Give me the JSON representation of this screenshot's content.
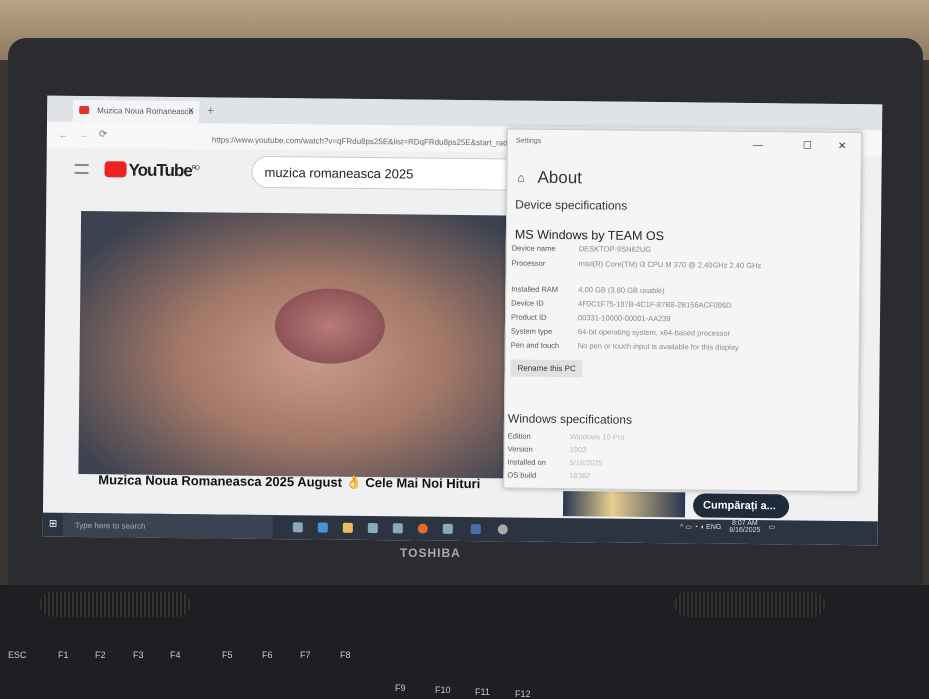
{
  "browser": {
    "tab_title": "Muzica Noua Romaneasca",
    "new_tab": "+",
    "url": "https://www.youtube.com/watch?v=qFRdu8ps25E&list=RDqFRdu8ps25E&start_rad",
    "back": "←",
    "forward": "→",
    "reload": "⟳"
  },
  "youtube": {
    "logo": "YouTube",
    "region": "RO",
    "search_value": "muzica romaneasca 2025",
    "video_title": "Muzica Noua Romaneasca 2025 August 👌 Cele Mai Noi Hituri",
    "buy_button": "Cumpărați a..."
  },
  "settings": {
    "window_title": "Settings",
    "page_title": "About",
    "device_specs_heading": "Device specifications",
    "device_heading": "MS Windows by TEAM OS",
    "device_rows": [
      {
        "label": "Device name",
        "value": "DESKTOP-9SN62UG"
      },
      {
        "label": "Processor",
        "value": "Intel(R) Core(TM) i3 CPU     M 370  @ 2.40GHz   2.40 GHz"
      },
      {
        "label": "Installed RAM",
        "value": "4.00 GB (3.80 GB usable)"
      },
      {
        "label": "Device ID",
        "value": "4F0C1F75-187B-4C1F-87B8-2B156ACF096D"
      },
      {
        "label": "Product ID",
        "value": "00331-10000-00001-AA239"
      },
      {
        "label": "System type",
        "value": "64-bit operating system, x64-based processor"
      },
      {
        "label": "Pen and touch",
        "value": "No pen or touch input is available for this display"
      }
    ],
    "rename_button": "Rename this PC",
    "windows_specs_heading": "Windows specifications",
    "windows_rows": [
      {
        "label": "Edition",
        "value": "Windows 10 Pro"
      },
      {
        "label": "Version",
        "value": "1903"
      },
      {
        "label": "Installed on",
        "value": "5/16/2025"
      },
      {
        "label": "OS build",
        "value": "18362"
      }
    ]
  },
  "taskbar": {
    "search_placeholder": "Type here to search",
    "language": "ENG",
    "time": "8:07 AM",
    "date": "8/16/2025"
  },
  "laptop": {
    "brand": "TOSHIBA",
    "keys": [
      "ESC",
      "F1",
      "F2",
      "F3",
      "F4",
      "F5",
      "F6",
      "F7",
      "F8",
      "F9",
      "F10",
      "F11",
      "F12"
    ]
  }
}
